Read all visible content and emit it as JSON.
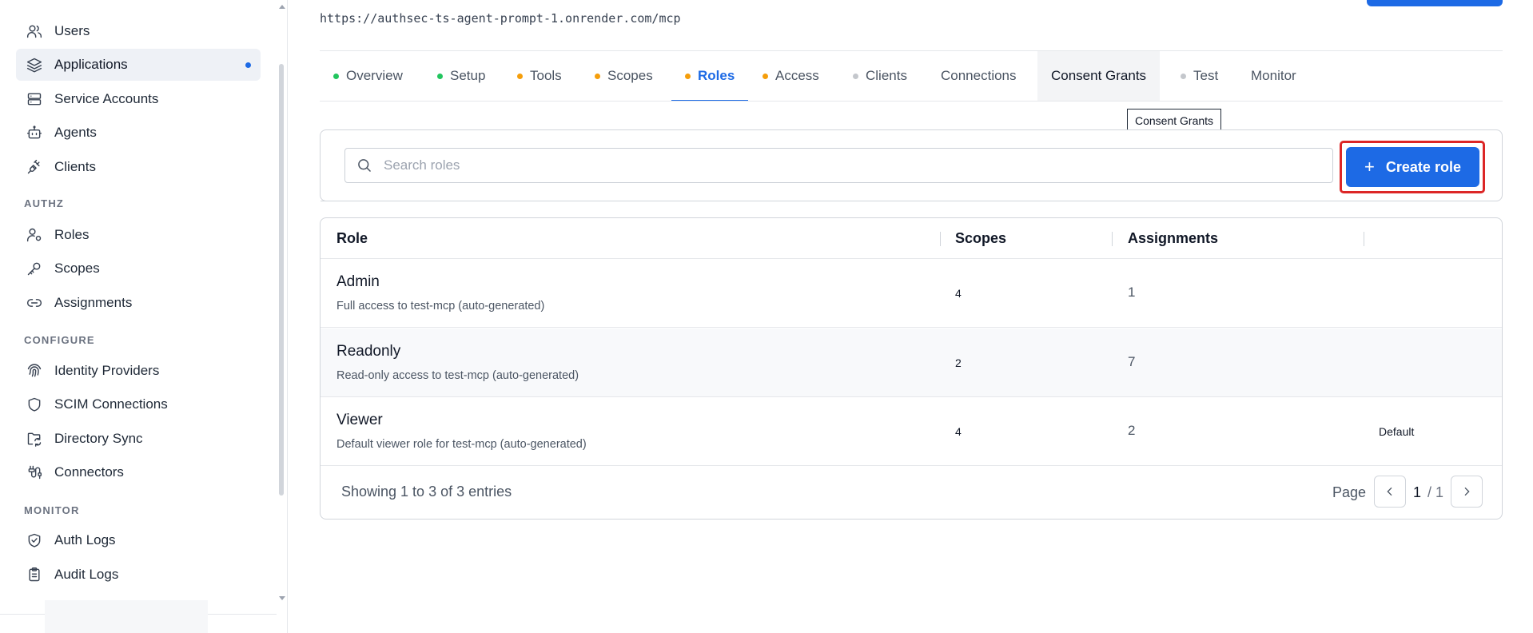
{
  "sidebar": {
    "items": [
      {
        "label": "Users",
        "icon": "users-icon"
      },
      {
        "label": "Applications",
        "icon": "layers-icon",
        "active": true
      },
      {
        "label": "Service Accounts",
        "icon": "server-icon"
      },
      {
        "label": "Agents",
        "icon": "bot-icon"
      },
      {
        "label": "Clients",
        "icon": "plug-icon"
      }
    ],
    "authz_label": "AUTHZ",
    "authz_items": [
      {
        "label": "Roles",
        "icon": "user-cog-icon"
      },
      {
        "label": "Scopes",
        "icon": "key-icon"
      },
      {
        "label": "Assignments",
        "icon": "link-icon"
      }
    ],
    "configure_label": "CONFIGURE",
    "configure_items": [
      {
        "label": "Identity Providers",
        "icon": "fingerprint-icon"
      },
      {
        "label": "SCIM Connections",
        "icon": "shield-icon"
      },
      {
        "label": "Directory Sync",
        "icon": "folder-sync-icon"
      },
      {
        "label": "Connectors",
        "icon": "cable-icon"
      }
    ],
    "monitor_label": "MONITOR",
    "monitor_items": [
      {
        "label": "Auth Logs",
        "icon": "shield-check-icon"
      },
      {
        "label": "Audit Logs",
        "icon": "clipboard-icon"
      }
    ]
  },
  "header": {
    "url": "https://authsec-ts-agent-prompt-1.onrender.com/mcp"
  },
  "tabs": [
    {
      "label": "Overview",
      "dot": "#22c55e"
    },
    {
      "label": "Setup",
      "dot": "#22c55e"
    },
    {
      "label": "Tools",
      "dot": "#f59e0b"
    },
    {
      "label": "Scopes",
      "dot": "#f59e0b"
    },
    {
      "label": "Roles",
      "dot": "#f59e0b",
      "active": true
    },
    {
      "label": "Access",
      "dot": "#f59e0b"
    },
    {
      "label": "Clients",
      "dot": "#c4c7cc"
    },
    {
      "label": "Connections",
      "dot": ""
    },
    {
      "label": "Consent Grants",
      "dot": "",
      "hover": true
    },
    {
      "label": "Test",
      "dot": "#c4c7cc"
    },
    {
      "label": "Monitor",
      "dot": ""
    }
  ],
  "tooltip": "Consent Grants",
  "search": {
    "placeholder": "Search roles",
    "value": ""
  },
  "create_button": {
    "plus": "+",
    "label": "Create role"
  },
  "table": {
    "columns": [
      "Role",
      "Scopes",
      "Assignments"
    ],
    "rows": [
      {
        "name": "Admin",
        "description": "Full access to test-mcp (auto-generated)",
        "scopes": "4",
        "assignments": "1",
        "badge": ""
      },
      {
        "name": "Readonly",
        "description": "Read-only access to test-mcp (auto-generated)",
        "scopes": "2",
        "assignments": "7",
        "badge": ""
      },
      {
        "name": "Viewer",
        "description": "Default viewer role for test-mcp (auto-generated)",
        "scopes": "4",
        "assignments": "2",
        "badge": "Default"
      }
    ]
  },
  "pagination": {
    "summary": "Showing 1 to 3 of 3 entries",
    "page_label": "Page",
    "current": "1",
    "total": "/ 1"
  },
  "colors": {
    "accent": "#1d6ae5",
    "highlight": "#dc2626",
    "status_green": "#22c55e",
    "status_amber": "#f59e0b",
    "status_gray": "#c4c7cc"
  }
}
